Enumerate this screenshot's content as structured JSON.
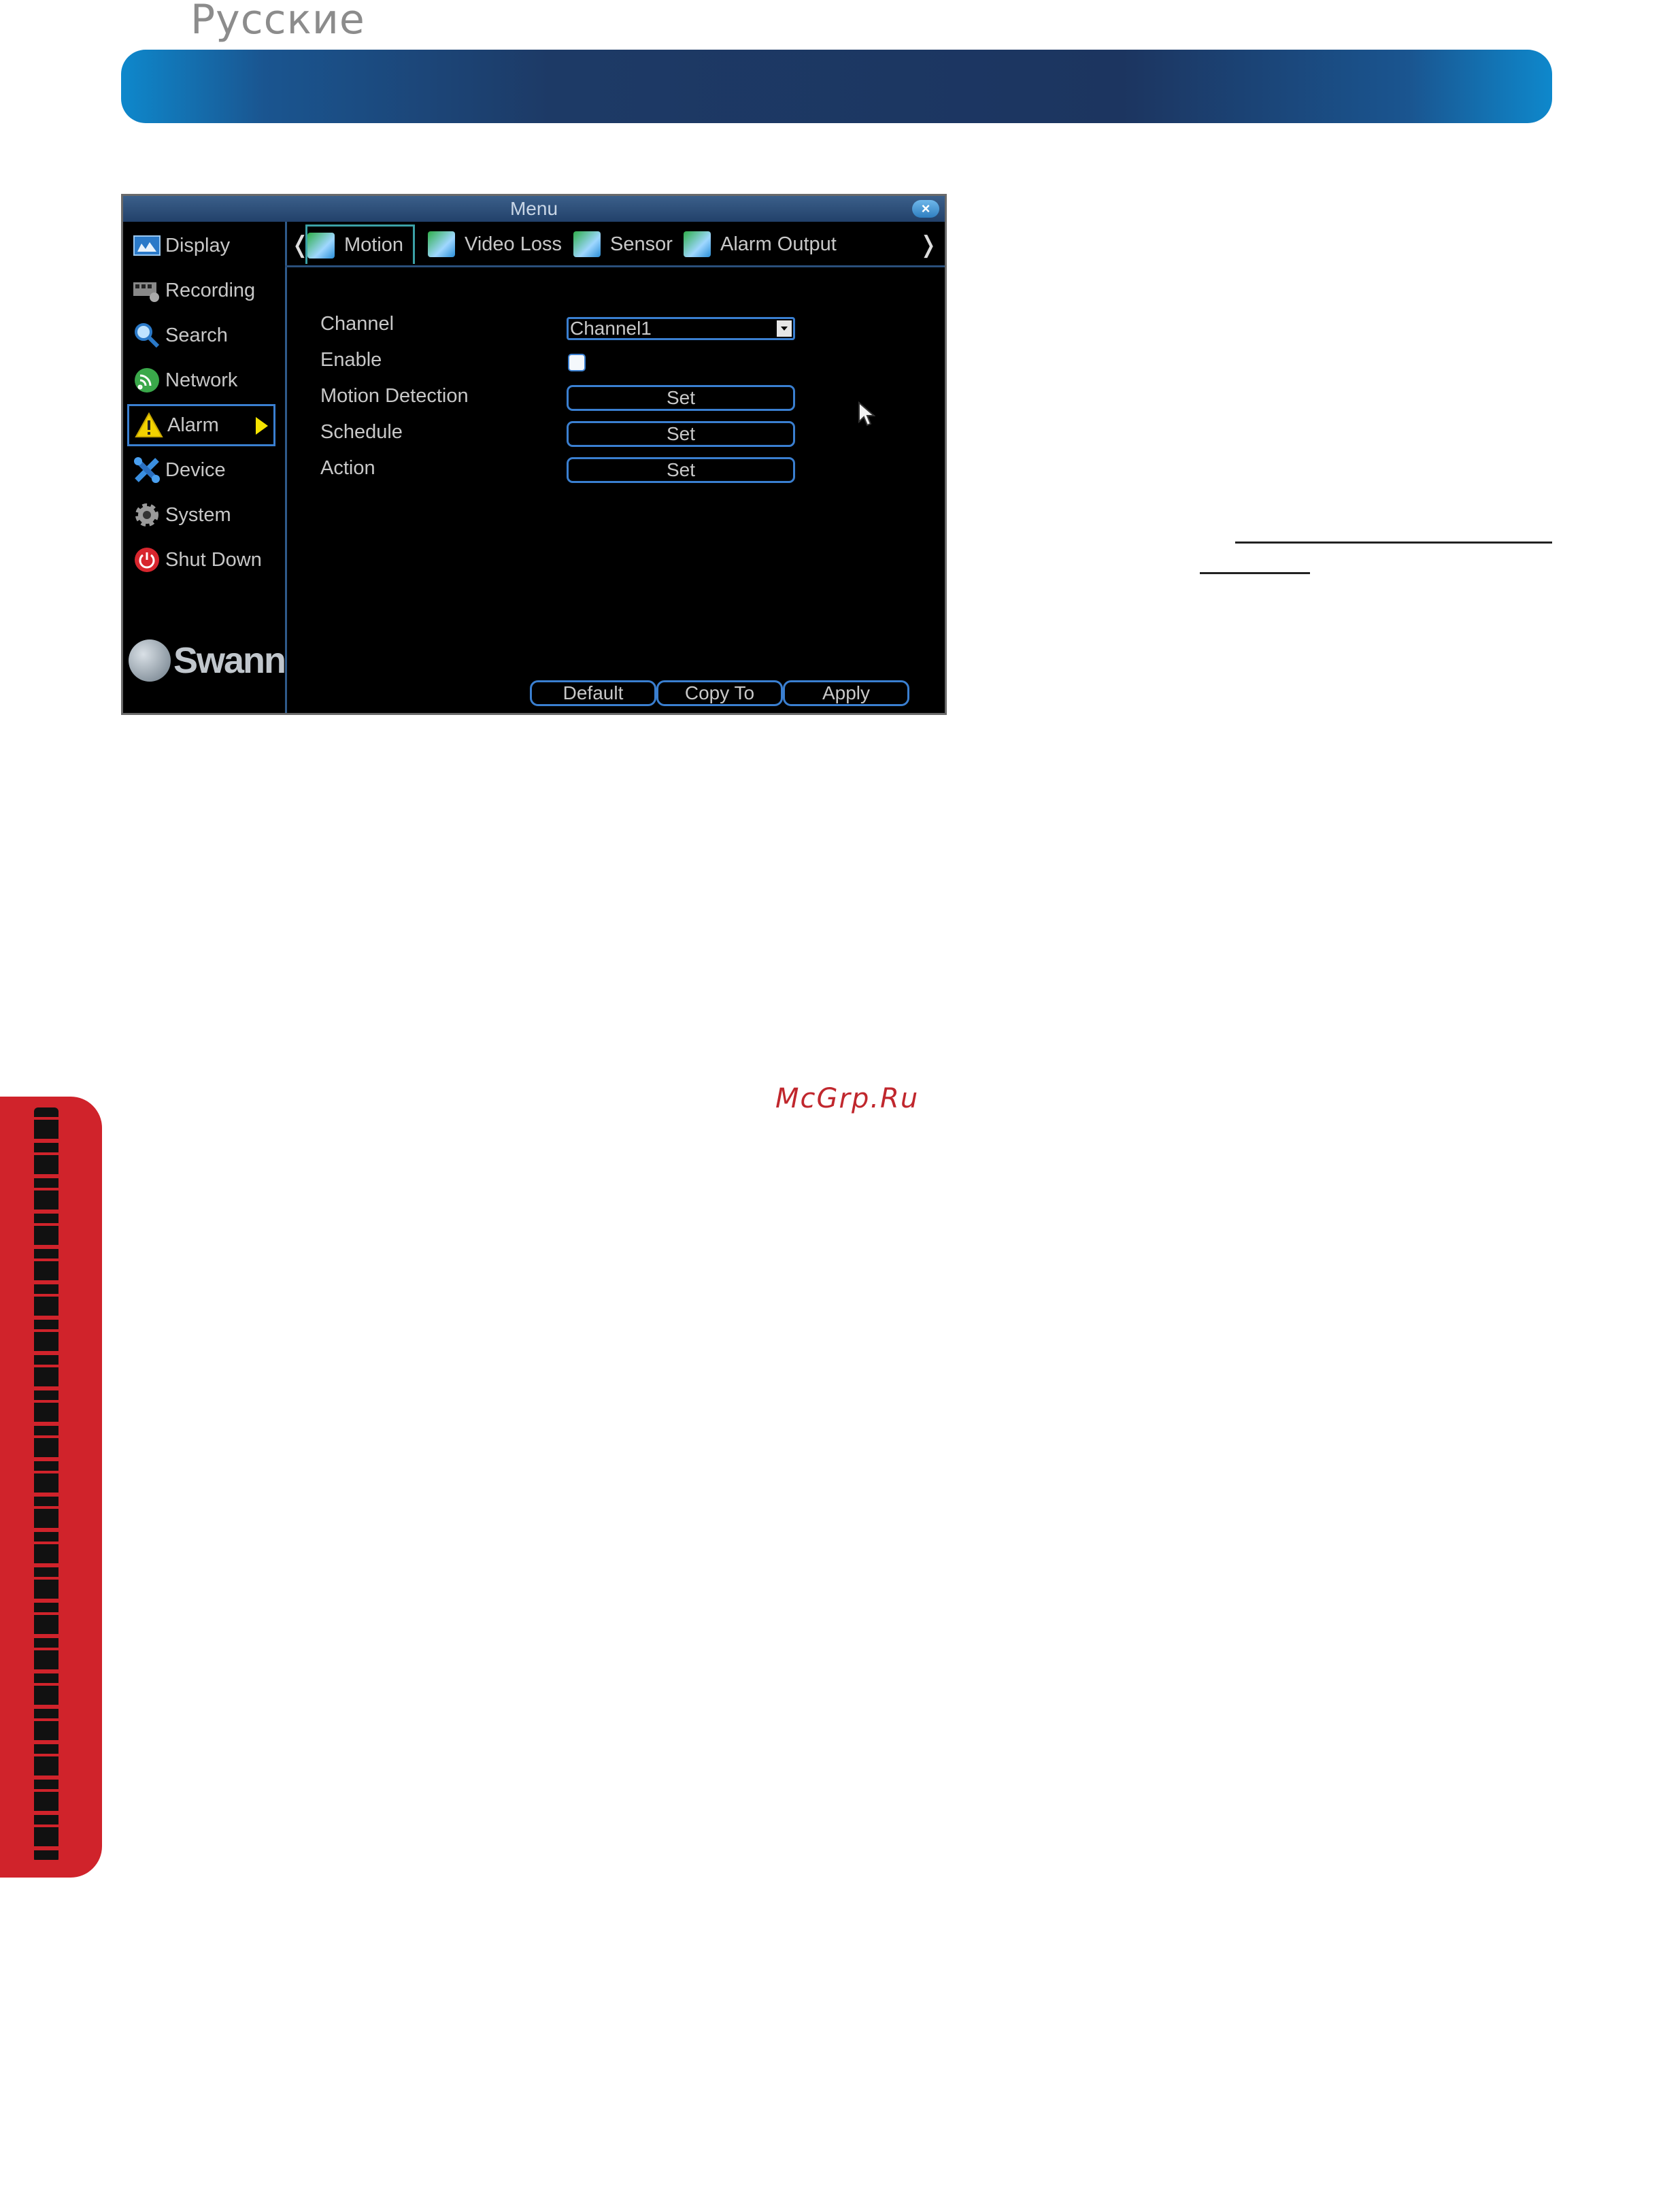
{
  "page": {
    "language_label": "Русские",
    "watermark": "McGrp.Ru",
    "header_color": "#1c3560",
    "side_tab_color": "#d0232b"
  },
  "window": {
    "title": "Menu",
    "close_glyph": "×",
    "brand": "Swann"
  },
  "sidebar": {
    "items": [
      {
        "label": "Display",
        "icon": "monitor-icon"
      },
      {
        "label": "Recording",
        "icon": "film-icon"
      },
      {
        "label": "Search",
        "icon": "magnifier-icon"
      },
      {
        "label": "Network",
        "icon": "network-icon"
      },
      {
        "label": "Alarm",
        "icon": "warning-icon",
        "active": true
      },
      {
        "label": "Device",
        "icon": "tools-icon"
      },
      {
        "label": "System",
        "icon": "gear-icon"
      },
      {
        "label": "Shut Down",
        "icon": "power-icon"
      }
    ]
  },
  "tabs": {
    "prev": "❬",
    "next": "❭",
    "items": [
      {
        "label": "Motion",
        "active": true
      },
      {
        "label": "Video Loss"
      },
      {
        "label": "Sensor"
      },
      {
        "label": "Alarm Output"
      }
    ]
  },
  "form": {
    "channel_label": "Channel",
    "channel_value": "Channel1",
    "enable_label": "Enable",
    "enable_checked": false,
    "motion_detection_label": "Motion Detection",
    "schedule_label": "Schedule",
    "action_label": "Action",
    "set_label": "Set"
  },
  "footer": {
    "default_label": "Default",
    "copy_to_label": "Copy To",
    "apply_label": "Apply"
  }
}
